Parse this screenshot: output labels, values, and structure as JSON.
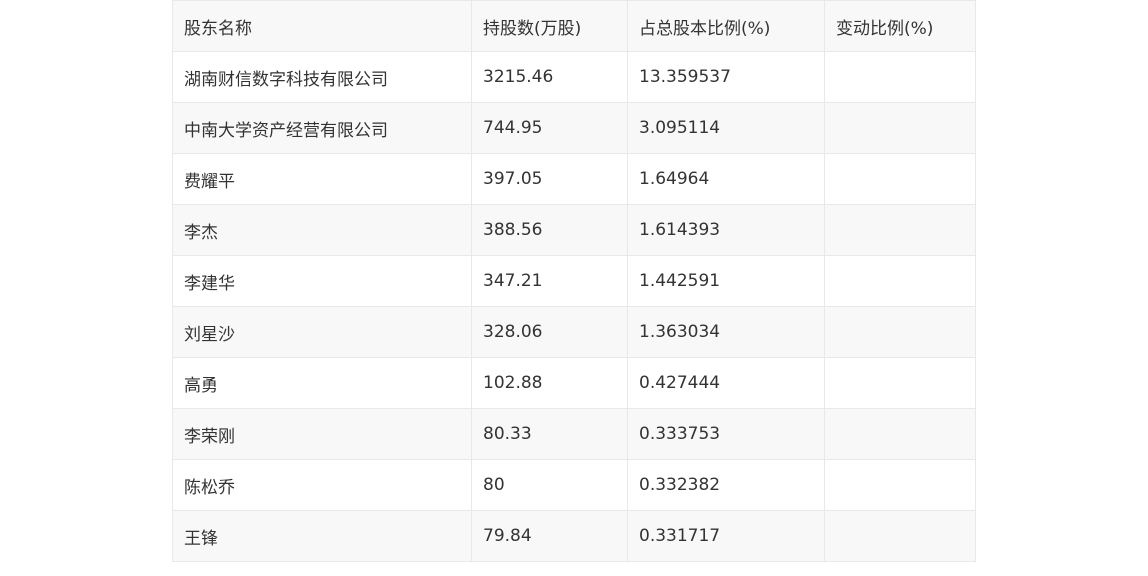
{
  "table": {
    "headers": [
      "股东名称",
      "持股数(万股)",
      "占总股本比例(%)",
      "变动比例(%)"
    ],
    "rows": [
      [
        "湖南财信数字科技有限公司",
        "3215.46",
        "13.359537",
        ""
      ],
      [
        "中南大学资产经营有限公司",
        "744.95",
        "3.095114",
        ""
      ],
      [
        "费耀平",
        "397.05",
        "1.64964",
        ""
      ],
      [
        "李杰",
        "388.56",
        "1.614393",
        ""
      ],
      [
        "李建华",
        "347.21",
        "1.442591",
        ""
      ],
      [
        "刘星沙",
        "328.06",
        "1.363034",
        ""
      ],
      [
        "高勇",
        "102.88",
        "0.427444",
        ""
      ],
      [
        "李荣刚",
        "80.33",
        "0.333753",
        ""
      ],
      [
        "陈松乔",
        "80",
        "0.332382",
        ""
      ],
      [
        "王锋",
        "79.84",
        "0.331717",
        ""
      ]
    ]
  }
}
